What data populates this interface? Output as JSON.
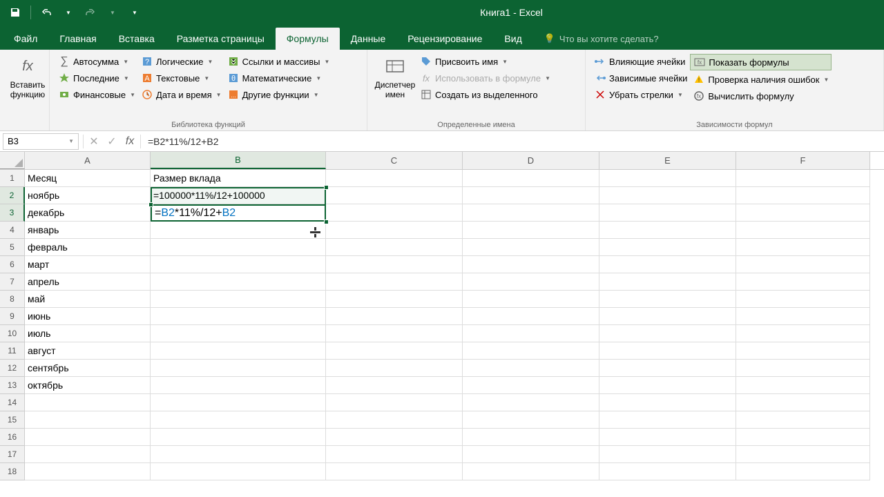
{
  "title": "Книга1 - Excel",
  "qat": {
    "save": "save",
    "undo": "undo",
    "redo": "redo"
  },
  "tabs": {
    "file": "Файл",
    "home": "Главная",
    "insert": "Вставка",
    "pagelayout": "Разметка страницы",
    "formulas": "Формулы",
    "data": "Данные",
    "review": "Рецензирование",
    "view": "Вид",
    "tellme": "Что вы хотите сделать?"
  },
  "ribbon": {
    "insert_function": "Вставить функцию",
    "library": {
      "autosum": "Автосумма",
      "recent": "Последние",
      "financial": "Финансовые",
      "logical": "Логические",
      "text": "Текстовые",
      "date_time": "Дата и время",
      "lookup": "Ссылки и массивы",
      "math": "Математические",
      "more": "Другие функции",
      "label": "Библиотека функций"
    },
    "names": {
      "manager": "Диспетчер имен",
      "define": "Присвоить имя",
      "use_in_formula": "Использовать в формуле",
      "create_from_selection": "Создать из выделенного",
      "label": "Определенные имена"
    },
    "auditing": {
      "trace_precedents": "Влияющие ячейки",
      "trace_dependents": "Зависимые ячейки",
      "remove_arrows": "Убрать стрелки",
      "show_formulas": "Показать формулы",
      "error_checking": "Проверка наличия ошибок",
      "evaluate": "Вычислить формулу",
      "label": "Зависимости формул"
    }
  },
  "namebox": "B3",
  "formula": "=B2*11%/12+B2",
  "columns": [
    "A",
    "B",
    "C",
    "D",
    "E",
    "F"
  ],
  "rows": [
    {
      "n": 1,
      "A": "Месяц",
      "B": "Размер вклада"
    },
    {
      "n": 2,
      "A": "ноябрь",
      "B": "=100000*11%/12+100000"
    },
    {
      "n": 3,
      "A": "декабрь",
      "B": "=B2*11%/12+B2"
    },
    {
      "n": 4,
      "A": "январь",
      "B": ""
    },
    {
      "n": 5,
      "A": "февраль",
      "B": ""
    },
    {
      "n": 6,
      "A": "март",
      "B": ""
    },
    {
      "n": 7,
      "A": "апрель",
      "B": ""
    },
    {
      "n": 8,
      "A": "май",
      "B": ""
    },
    {
      "n": 9,
      "A": "июнь",
      "B": ""
    },
    {
      "n": 10,
      "A": "июль",
      "B": ""
    },
    {
      "n": 11,
      "A": "август",
      "B": ""
    },
    {
      "n": 12,
      "A": "сентябрь",
      "B": ""
    },
    {
      "n": 13,
      "A": "октябрь",
      "B": ""
    },
    {
      "n": 14,
      "A": "",
      "B": ""
    },
    {
      "n": 15,
      "A": "",
      "B": ""
    },
    {
      "n": 16,
      "A": "",
      "B": ""
    },
    {
      "n": 17,
      "A": "",
      "B": ""
    },
    {
      "n": 18,
      "A": "",
      "B": ""
    }
  ],
  "chart_data": {
    "type": "table",
    "title": "Размер вклада (показ формул)",
    "columns": [
      "Месяц",
      "Размер вклада"
    ],
    "rows": [
      [
        "ноябрь",
        "=100000*11%/12+100000"
      ],
      [
        "декабрь",
        "=B2*11%/12+B2"
      ],
      [
        "январь",
        ""
      ],
      [
        "февраль",
        ""
      ],
      [
        "март",
        ""
      ],
      [
        "апрель",
        ""
      ],
      [
        "май",
        ""
      ],
      [
        "июнь",
        ""
      ],
      [
        "июль",
        ""
      ],
      [
        "август",
        ""
      ],
      [
        "сентябрь",
        ""
      ],
      [
        "октябрь",
        ""
      ]
    ]
  }
}
